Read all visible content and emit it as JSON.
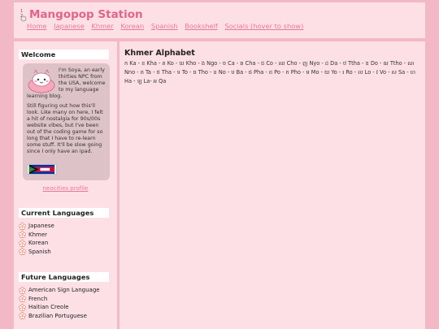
{
  "header": {
    "logo_text": "1 2",
    "title": "Mangopop Station",
    "nav": [
      "Home",
      "Japanese",
      "Khmer",
      "Korean",
      "Spanish",
      "Bookshelf",
      "Socials (hover to show)"
    ]
  },
  "sidebar": {
    "welcome": {
      "heading": "Welcome",
      "intro": "I'm Soya, an early thirties NPC from the USA, welcome to my language learning blog.",
      "body": "Still figuring out how this'll look. Like many on here, I felt a hit of nostalgia for 90s/00s website vibes, but I've been out of the coding game for so long that I have to re-learn some stuff. It'll be slow going since I only have an ipad."
    },
    "neocities_link": "neocities profile",
    "current_heading": "Current Languages",
    "current": [
      "Japanese",
      "Khmer",
      "Korean",
      "Spanish"
    ],
    "future_heading": "Future Languages",
    "future": [
      "American Sign Language",
      "French",
      "Haitian Creole",
      "Brazilian Portuguese"
    ]
  },
  "main": {
    "title": "Khmer Alphabet",
    "alphabet": "ក Ka - ខ Kha - គ Ko - ឃ Kho - ង Ngo - ច Ca - ឆ Cha - ជ Co - ឈ Cho - ញ Nyo - ដ Da - ឋ Ttha - ឌ Do - ឍ Ttho - ណ Nno - ត Ta - ថ Tha - ទ To - ធ Tho - ន No - ប Ba - ផ Pha - ព Po - ភ Pho - ម Mo - យ Yo - រ Ro - ល Lo - វ Vo - ស Sa - ហ Ha - ឡ La- អ Qa"
  },
  "colors": {
    "accent": "#e2648a",
    "link": "#e8779a",
    "panel": "#fde0e6",
    "background": "#f2b8c6"
  }
}
